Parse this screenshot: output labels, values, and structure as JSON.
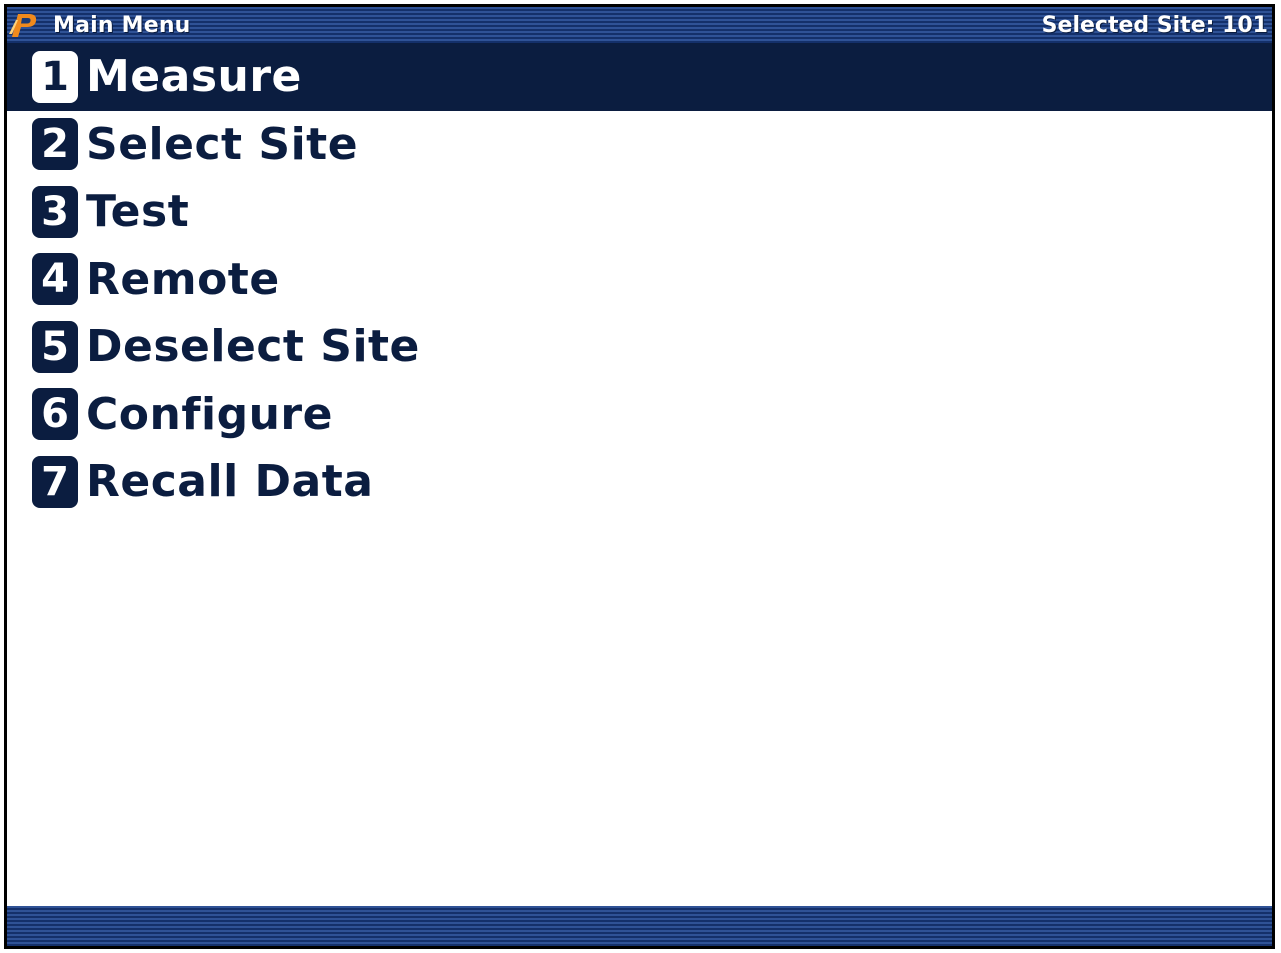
{
  "header": {
    "title": "Main Menu",
    "site_status": "Selected Site: 101",
    "logo_icon": "p-logo-icon"
  },
  "menu": {
    "selected_index": 0,
    "items": [
      {
        "number": "1",
        "label": "Measure"
      },
      {
        "number": "2",
        "label": "Select Site"
      },
      {
        "number": "3",
        "label": "Test"
      },
      {
        "number": "4",
        "label": "Remote"
      },
      {
        "number": "5",
        "label": "Deselect Site"
      },
      {
        "number": "6",
        "label": "Configure"
      },
      {
        "number": "7",
        "label": "Recall Data"
      }
    ]
  },
  "colors": {
    "navy": "#0b1d40",
    "bar_blue": "#1b3a73",
    "logo_orange": "#f08a1c",
    "background": "#ffffff"
  }
}
